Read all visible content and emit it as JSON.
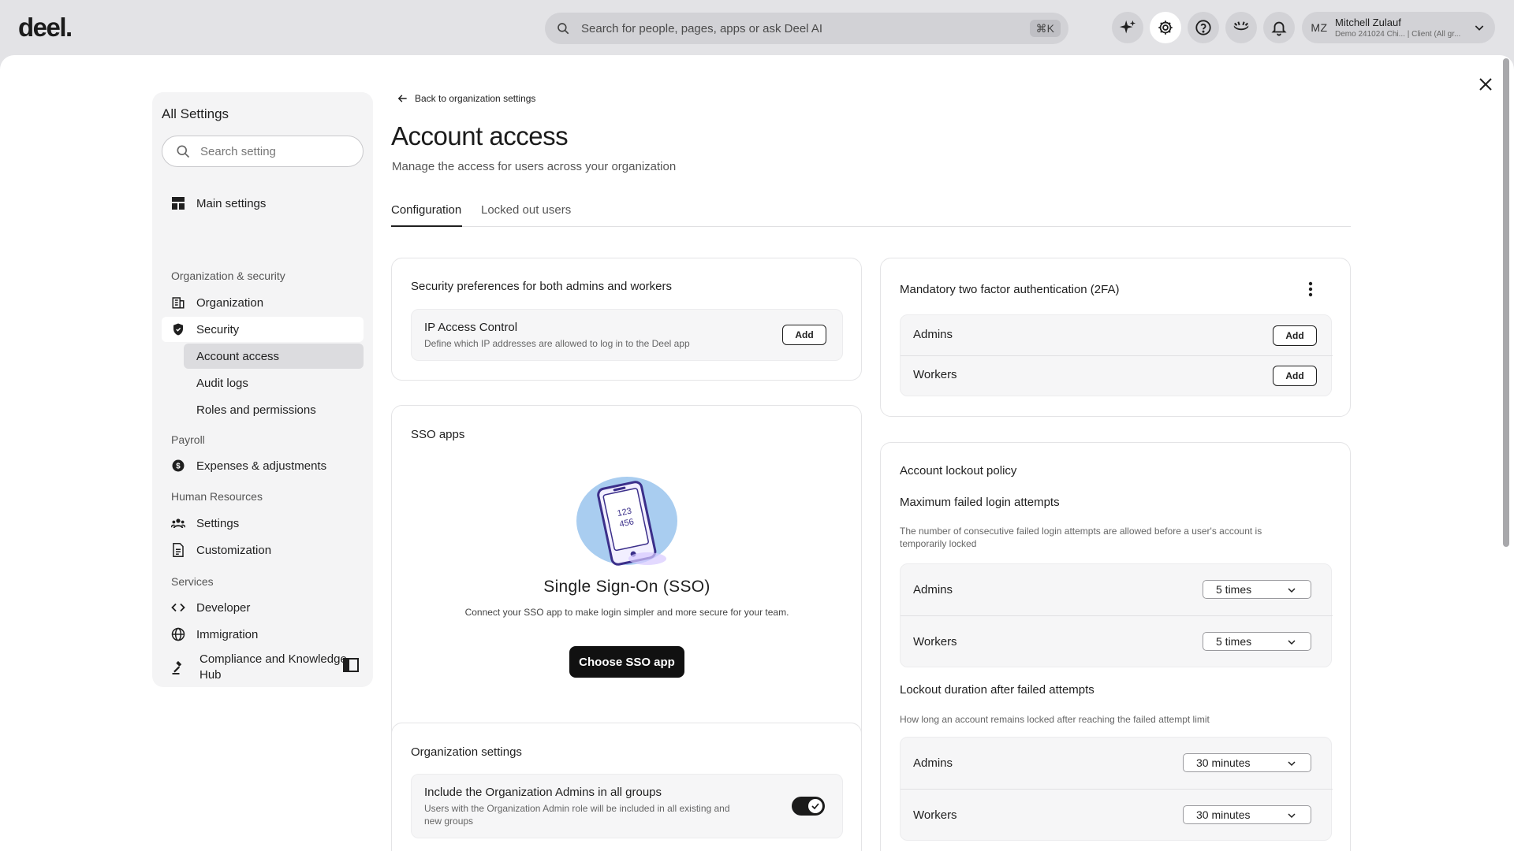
{
  "topbar": {
    "logo": "deel.",
    "search_placeholder": "Search for people, pages, apps or ask Deel AI",
    "shortcut": "⌘K",
    "user": {
      "initials": "MZ",
      "name": "Mitchell Zulauf",
      "subtitle": "Demo 241024 Chi... | Client (All gr..."
    }
  },
  "sidebar": {
    "title": "All Settings",
    "search_placeholder": "Search setting",
    "main_settings": "Main settings",
    "groups": {
      "org_security": "Organization & security",
      "payroll": "Payroll",
      "hr": "Human Resources",
      "services": "Services"
    },
    "items": {
      "organization": "Organization",
      "security": "Security",
      "account_access": "Account access",
      "audit_logs": "Audit logs",
      "roles": "Roles and permissions",
      "expenses": "Expenses & adjustments",
      "hr_settings": "Settings",
      "customization": "Customization",
      "developer": "Developer",
      "immigration": "Immigration",
      "compliance_line1": "Compliance and Knowledge",
      "compliance_line2": "Hub"
    }
  },
  "page": {
    "back": "Back to organization settings",
    "title": "Account access",
    "subtitle": "Manage the access for users across your organization",
    "tabs": [
      "Configuration",
      "Locked out users"
    ],
    "active_tab": "Configuration"
  },
  "security_prefs": {
    "title": "Security preferences for both admins and workers",
    "ip_title": "IP Access Control",
    "ip_desc": "Define which IP addresses are allowed to log in to the Deel app",
    "add": "Add"
  },
  "sso": {
    "title": "SSO apps",
    "phone_digits_1": "123",
    "phone_digits_2": "456",
    "heading": "Single Sign-On (SSO)",
    "desc": "Connect your SSO app to make login simpler and more secure for your team.",
    "button": "Choose SSO app"
  },
  "org_settings": {
    "title": "Organization settings",
    "row_title": "Include the Organization Admins in all groups",
    "row_desc_1": "Users with the Organization Admin role will be included in all existing and",
    "row_desc_2": "new groups",
    "toggle_on": true
  },
  "twofa": {
    "title": "Mandatory two factor authentication (2FA)",
    "admins": "Admins",
    "workers": "Workers",
    "add": "Add"
  },
  "lockout": {
    "title": "Account lockout policy",
    "max_title": "Maximum failed login attempts",
    "max_desc_1": "The number of consecutive failed login attempts are allowed before a user's account is",
    "max_desc_2": "temporarily locked",
    "admins": "Admins",
    "workers": "Workers",
    "admins_attempts": "5 times",
    "workers_attempts": "5 times",
    "duration_title": "Lockout duration after failed attempts",
    "duration_desc": "How long an account remains locked after reaching the failed attempt limit",
    "admins_duration": "30 minutes",
    "workers_duration": "30 minutes"
  }
}
